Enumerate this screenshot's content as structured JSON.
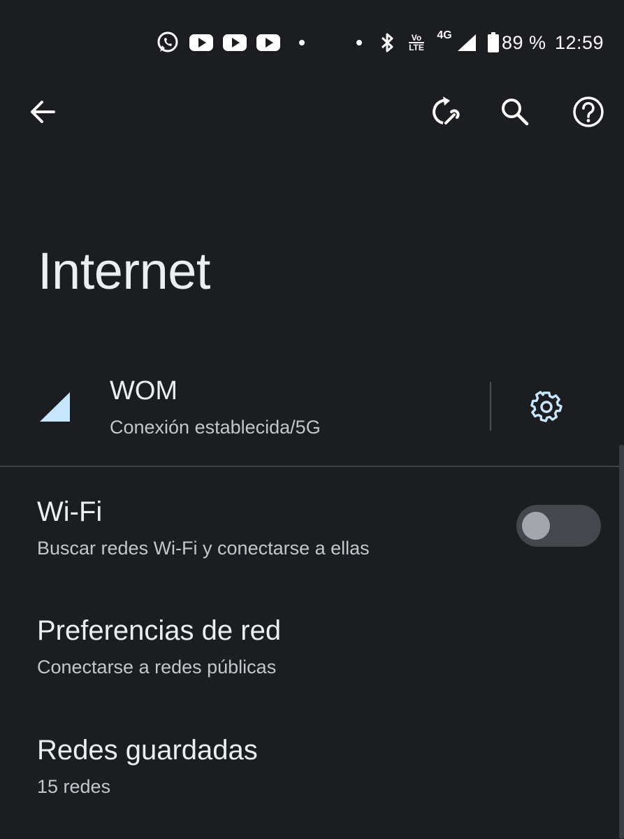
{
  "status_bar": {
    "notification_icons": [
      "whatsapp-icon",
      "youtube-icon",
      "youtube-icon",
      "youtube-icon",
      "dot-icon"
    ],
    "system_icons": [
      "dot-icon",
      "bluetooth-icon",
      "volte-icon",
      "4g-icon",
      "signal-icon",
      "battery-icon"
    ],
    "volte_top": "Vo",
    "volte_bottom": "LTE",
    "network_type": "4G",
    "battery": "89 %",
    "time": "12:59"
  },
  "toolbar": {
    "back_icon": "arrow-back-icon",
    "reset_icon": "network-reset-icon",
    "search_icon": "search-icon",
    "help_icon": "help-icon"
  },
  "page": {
    "title": "Internet"
  },
  "carrier": {
    "name": "WOM",
    "status": "Conexión establecida/5G",
    "signal_icon": "cell-signal-icon",
    "settings_icon": "gear-icon"
  },
  "items": [
    {
      "title": "Wi-Fi",
      "subtitle": "Buscar redes Wi-Fi y conectarse a ellas",
      "toggle_on": false
    },
    {
      "title": "Preferencias de red",
      "subtitle": "Conectarse a redes públicas"
    },
    {
      "title": "Redes guardadas",
      "subtitle": "15 redes"
    }
  ],
  "colors": {
    "background": "#1b1d20",
    "accent": "#c8e6ff",
    "toggle_track_off": "#44474b",
    "toggle_knob_off": "#a3a6ab"
  }
}
